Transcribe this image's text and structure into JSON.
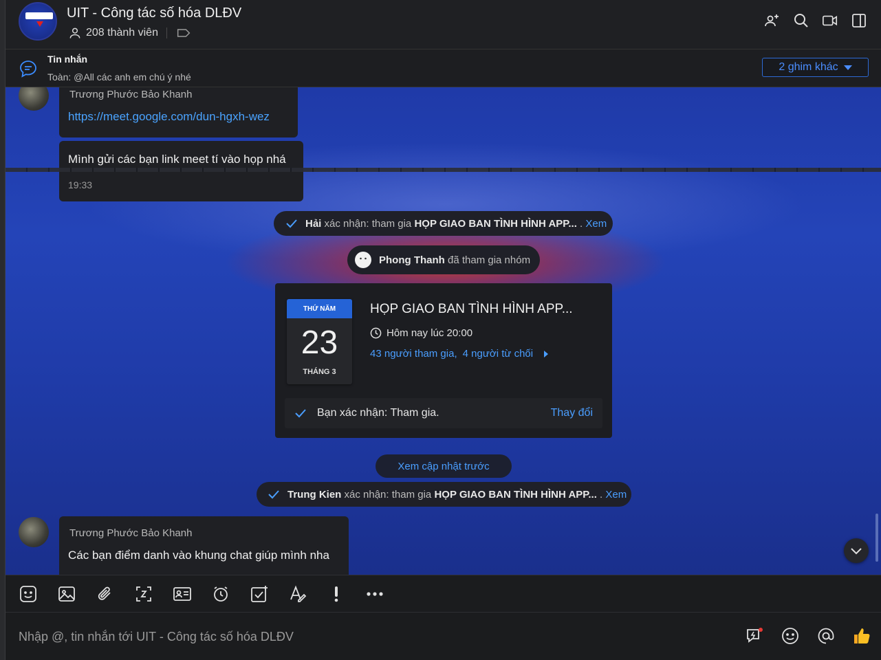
{
  "header": {
    "title": "UIT - Công tác số hóa DLĐV",
    "members": "208 thành viên"
  },
  "pinned": {
    "title": "Tin nhắn",
    "text": "Toàn: @All các anh em chú ý nhé",
    "more_label": "2 ghim khác"
  },
  "messages": {
    "first": {
      "sender": "Trương Phước Bảo Khanh",
      "link": "https://meet.google.com/dun-hgxh-wez",
      "text": "Mình gửi các bạn link meet tí vào họp nhá",
      "time": "19:33"
    },
    "last": {
      "sender": "Trương Phước Bảo Khanh",
      "text": "Các bạn điểm danh vào khung chat giúp mình nha"
    }
  },
  "system": {
    "hai": {
      "name": "Hải",
      "action": " xác nhận: tham gia ",
      "event": "HỌP GIAO BAN TÌNH HÌNH APP...",
      "dot": " . ",
      "link": "Xem"
    },
    "join": {
      "name": "Phong Thanh",
      "action": " đã tham gia nhóm"
    },
    "kien": {
      "name": "Trung Kien",
      "action": " xác nhận: tham gia ",
      "event": "HỌP GIAO BAN TÌNH HÌNH APP...",
      "dot": " . ",
      "link": "Xem"
    }
  },
  "event": {
    "weekday": "THỨ NĂM",
    "day": "23",
    "month": "THÁNG 3",
    "title": "HỌP GIAO BAN TÌNH HÌNH APP...",
    "time": "Hôm nay lúc 20:00",
    "attending": "43 người tham gia,",
    "declined": "4 người từ chối",
    "confirm": "Bạn xác nhận: Tham gia.",
    "change": "Thay đổi"
  },
  "prev_updates": "Xem cập nhật trước",
  "composer": {
    "placeholder": "Nhập @, tin nhắn tới UIT - Công tác số hóa DLĐV"
  },
  "colors": {
    "accent": "#4a9eff",
    "chat_bg": "#2444b8",
    "calendar_header": "#2563d6"
  }
}
